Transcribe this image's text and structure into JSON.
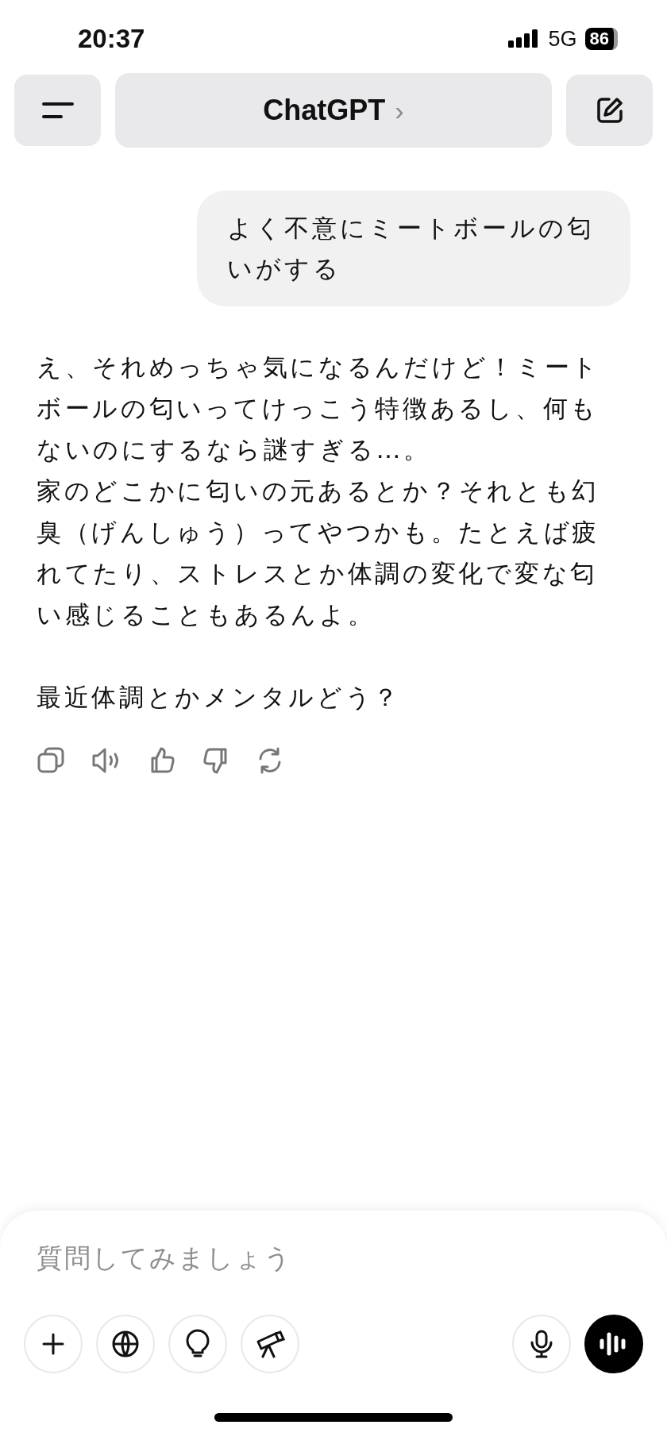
{
  "status_bar": {
    "time": "20:37",
    "network": "5G",
    "battery": "86"
  },
  "header": {
    "title": "ChatGPT",
    "title_chevron": "›"
  },
  "messages": [
    {
      "kind": "user",
      "paragraphs": [
        "よく不意にミートボールの匂いがする"
      ]
    },
    {
      "kind": "assistant",
      "paragraphs": [
        "え、それめっちゃ気になるんだけど！ミートボールの匂いってけっこう特徴あるし、何もないのにするなら謎すぎる…。",
        "家のどこかに匂いの元あるとか？それとも幻臭（げんしゅう）ってやつかも。たとえば疲れてたり、ストレスとか体調の変化で変な匂い感じることもあるんよ。",
        {
          "text": "最近体調とかメンタルどう？",
          "space_before": true
        }
      ]
    }
  ],
  "composer": {
    "placeholder": "質問してみましょう"
  }
}
